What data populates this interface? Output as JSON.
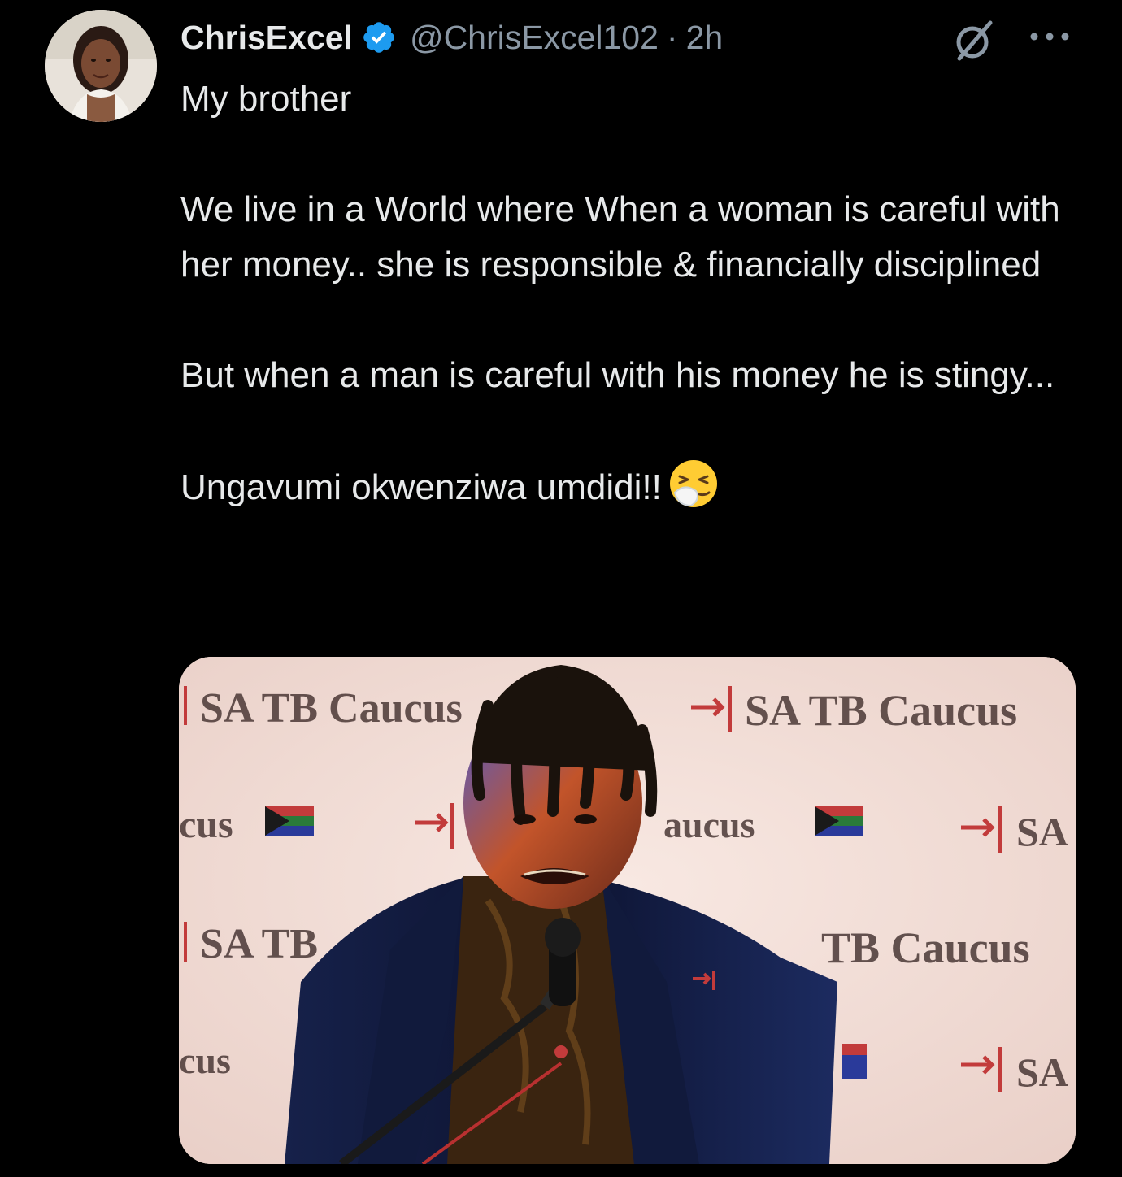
{
  "tweet": {
    "author": {
      "display_name": "ChrisExcel",
      "handle": "@ChrisExcel102",
      "verified": true,
      "avatar_icon": "user-avatar"
    },
    "separator": "·",
    "time": "2h",
    "actions": {
      "grok_icon": "grok-icon",
      "more_icon": "more-icon"
    },
    "text": {
      "line1": "My brother",
      "paragraph1": "We live in a World where When a woman is careful with her money.. she is responsible & financially disciplined",
      "paragraph2": "But when a man is careful with his money he is stingy...",
      "paragraph3": "Ungavumi okwenziwa umdidi!!",
      "emoji": "sneezing-face-emoji"
    },
    "media": {
      "type": "photo",
      "backdrop_texts": [
        "SA TB Caucus",
        "SA TB Caucus",
        "cus",
        "aucus",
        "SA",
        "SA TB",
        "TB Caucus",
        "cus",
        "SA"
      ]
    }
  },
  "colors": {
    "background": "#000000",
    "text_primary": "#e7e9ea",
    "text_secondary": "#8b98a5",
    "verified_blue": "#1d9bf0",
    "backdrop": "#f3ddd6"
  }
}
